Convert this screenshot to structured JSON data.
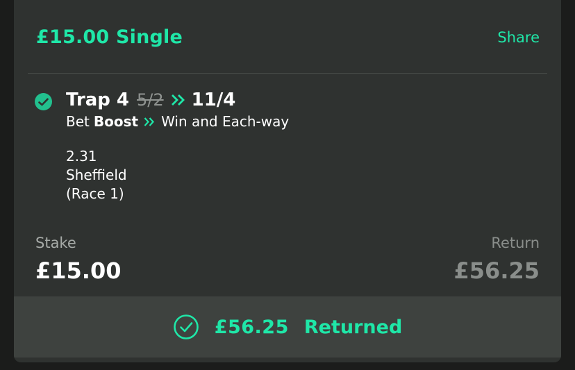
{
  "bet": {
    "title": "£15.00 Single",
    "share_label": "Share"
  },
  "selection": {
    "runner": "Trap 4",
    "old_odds": "5/2",
    "new_odds": "11/4",
    "boost_prefix": "Bet",
    "boost_word": "Boost",
    "market": "Win and Each-way",
    "event_time": "2.31",
    "venue": "Sheffield",
    "race": "(Race 1)"
  },
  "stake": {
    "label": "Stake",
    "value": "£15.00"
  },
  "return": {
    "label": "Return",
    "value": "£56.25"
  },
  "result": {
    "amount": "£56.25",
    "status": "Returned"
  },
  "colors": {
    "accent": "#1fe7a8",
    "card_bg": "#2f3230",
    "footer_bg": "#3e423f",
    "check_bg": "#22c08e"
  },
  "icons": {
    "selection_status": "check-circle-icon",
    "boost": "double-chevron-right-icon",
    "result": "check-circle-outline-icon"
  }
}
